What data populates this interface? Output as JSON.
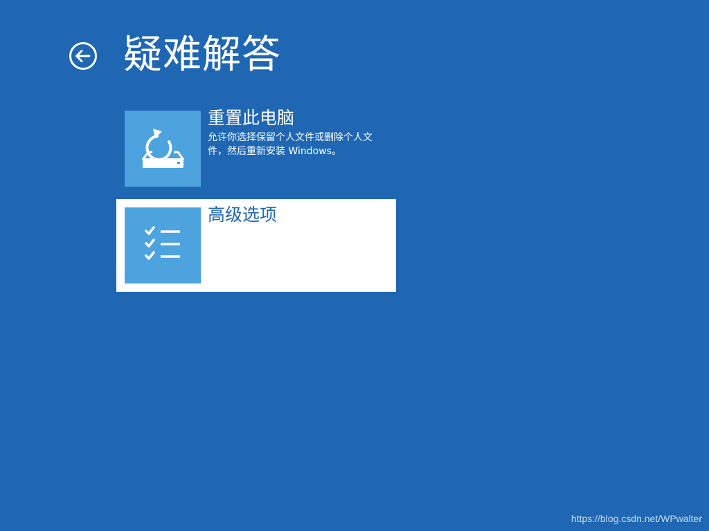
{
  "header": {
    "title": "疑难解答",
    "back_icon": "back-arrow-circle-icon"
  },
  "options": [
    {
      "title": "重置此电脑",
      "description": "允许你选择保留个人文件或删除个人文件，然后重新安装 Windows。",
      "icon": "reset-pc-icon",
      "selected": false
    },
    {
      "title": "高级选项",
      "description": "",
      "icon": "checklist-icon",
      "selected": true
    }
  ],
  "watermark": "https://blog.csdn.net/WPwalter",
  "colors": {
    "background": "#1f67b3",
    "tile": "#4ca3de",
    "selected_background": "#ffffff",
    "text": "#ffffff"
  }
}
